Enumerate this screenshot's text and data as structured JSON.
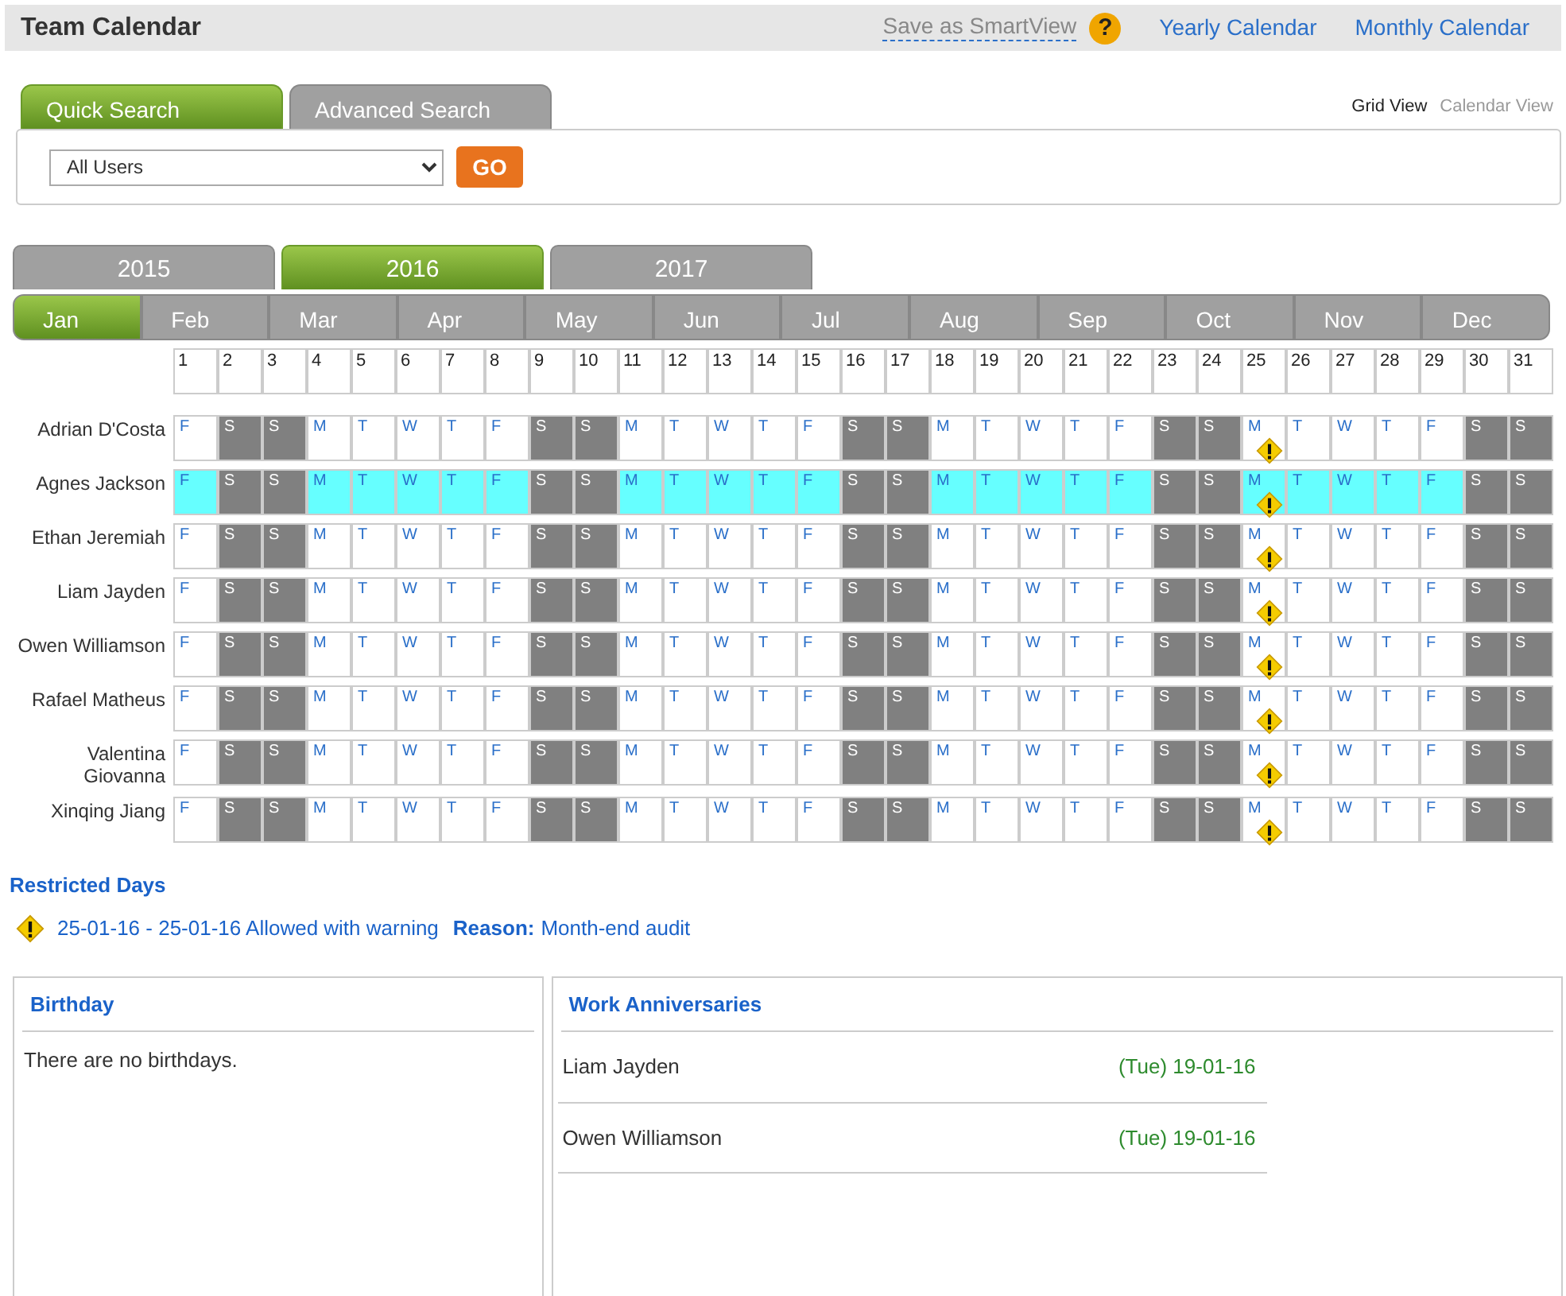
{
  "header": {
    "title": "Team Calendar",
    "save_link": "Save as SmartView",
    "help": "?",
    "links": [
      "Yearly Calendar",
      "Monthly Calendar"
    ]
  },
  "search_tabs": [
    {
      "label": "Quick Search",
      "selected": true
    },
    {
      "label": "Advanced Search",
      "selected": false
    }
  ],
  "views": [
    {
      "label": "Grid View",
      "selected": true
    },
    {
      "label": "Calendar View",
      "selected": false
    }
  ],
  "search": {
    "user_select": "All Users",
    "go_button": "GO"
  },
  "years": [
    {
      "label": "2015",
      "selected": false
    },
    {
      "label": "2016",
      "selected": true
    },
    {
      "label": "2017",
      "selected": false
    }
  ],
  "months": [
    {
      "label": "Jan",
      "selected": true
    },
    {
      "label": "Feb",
      "selected": false
    },
    {
      "label": "Mar",
      "selected": false
    },
    {
      "label": "Apr",
      "selected": false
    },
    {
      "label": "May",
      "selected": false
    },
    {
      "label": "Jun",
      "selected": false
    },
    {
      "label": "Jul",
      "selected": false
    },
    {
      "label": "Aug",
      "selected": false
    },
    {
      "label": "Sep",
      "selected": false
    },
    {
      "label": "Oct",
      "selected": false
    },
    {
      "label": "Nov",
      "selected": false
    },
    {
      "label": "Dec",
      "selected": false
    }
  ],
  "days": [
    {
      "number": "1",
      "weekend": false,
      "restricted": false
    },
    {
      "number": "2",
      "weekend": true,
      "restricted": false
    },
    {
      "number": "3",
      "weekend": true,
      "restricted": false
    },
    {
      "number": "4",
      "weekend": false,
      "restricted": false
    },
    {
      "number": "5",
      "weekend": false,
      "restricted": false
    },
    {
      "number": "6",
      "weekend": false,
      "restricted": false
    },
    {
      "number": "7",
      "weekend": false,
      "restricted": false
    },
    {
      "number": "8",
      "weekend": false,
      "restricted": false
    },
    {
      "number": "9",
      "weekend": true,
      "restricted": false
    },
    {
      "number": "10",
      "weekend": true,
      "restricted": false
    },
    {
      "number": "11",
      "weekend": false,
      "restricted": false
    },
    {
      "number": "12",
      "weekend": false,
      "restricted": false
    },
    {
      "number": "13",
      "weekend": false,
      "restricted": false
    },
    {
      "number": "14",
      "weekend": false,
      "restricted": false
    },
    {
      "number": "15",
      "weekend": false,
      "restricted": false
    },
    {
      "number": "16",
      "weekend": true,
      "restricted": false
    },
    {
      "number": "17",
      "weekend": true,
      "restricted": false
    },
    {
      "number": "18",
      "weekend": false,
      "restricted": false
    },
    {
      "number": "19",
      "weekend": false,
      "restricted": false
    },
    {
      "number": "20",
      "weekend": false,
      "restricted": false
    },
    {
      "number": "21",
      "weekend": false,
      "restricted": false
    },
    {
      "number": "22",
      "weekend": false,
      "restricted": false
    },
    {
      "number": "23",
      "weekend": true,
      "restricted": false
    },
    {
      "number": "24",
      "weekend": true,
      "restricted": false
    },
    {
      "number": "25",
      "weekend": false,
      "restricted": true
    },
    {
      "number": "26",
      "weekend": false,
      "restricted": false
    },
    {
      "number": "27",
      "weekend": false,
      "restricted": false
    },
    {
      "number": "28",
      "weekend": false,
      "restricted": false
    },
    {
      "number": "29",
      "weekend": false,
      "restricted": false
    },
    {
      "number": "30",
      "weekend": true,
      "restricted": false
    },
    {
      "number": "31",
      "weekend": true,
      "restricted": false
    }
  ],
  "employees": [
    {
      "name": "Adrian D'Costa",
      "highlighted": false,
      "cells": [
        "F",
        "S",
        "S",
        "M",
        "T",
        "W",
        "T",
        "F",
        "S",
        "S",
        "M",
        "T",
        "W",
        "T",
        "F",
        "S",
        "S",
        "M",
        "T",
        "W",
        "T",
        "F",
        "S",
        "S",
        "M",
        "T",
        "W",
        "T",
        "F",
        "S",
        "S"
      ]
    },
    {
      "name": "Agnes Jackson",
      "highlighted": true,
      "cells": [
        "F",
        "S",
        "S",
        "M",
        "T",
        "W",
        "T",
        "F",
        "S",
        "S",
        "M",
        "T",
        "W",
        "T",
        "F",
        "S",
        "S",
        "M",
        "T",
        "W",
        "T",
        "F",
        "S",
        "S",
        "M",
        "T",
        "W",
        "T",
        "F",
        "S",
        "S"
      ]
    },
    {
      "name": "Ethan Jeremiah",
      "highlighted": false,
      "cells": [
        "F",
        "S",
        "S",
        "M",
        "T",
        "W",
        "T",
        "F",
        "S",
        "S",
        "M",
        "T",
        "W",
        "T",
        "F",
        "S",
        "S",
        "M",
        "T",
        "W",
        "T",
        "F",
        "S",
        "S",
        "M",
        "T",
        "W",
        "T",
        "F",
        "S",
        "S"
      ]
    },
    {
      "name": "Liam Jayden",
      "highlighted": false,
      "cells": [
        "F",
        "S",
        "S",
        "M",
        "T",
        "W",
        "T",
        "F",
        "S",
        "S",
        "M",
        "T",
        "W",
        "T",
        "F",
        "S",
        "S",
        "M",
        "T",
        "W",
        "T",
        "F",
        "S",
        "S",
        "M",
        "T",
        "W",
        "T",
        "F",
        "S",
        "S"
      ]
    },
    {
      "name": "Owen Williamson",
      "highlighted": false,
      "cells": [
        "F",
        "S",
        "S",
        "M",
        "T",
        "W",
        "T",
        "F",
        "S",
        "S",
        "M",
        "T",
        "W",
        "T",
        "F",
        "S",
        "S",
        "M",
        "T",
        "W",
        "T",
        "F",
        "S",
        "S",
        "M",
        "T",
        "W",
        "T",
        "F",
        "S",
        "S"
      ]
    },
    {
      "name": "Rafael Matheus",
      "highlighted": false,
      "cells": [
        "F",
        "S",
        "S",
        "M",
        "T",
        "W",
        "T",
        "F",
        "S",
        "S",
        "M",
        "T",
        "W",
        "T",
        "F",
        "S",
        "S",
        "M",
        "T",
        "W",
        "T",
        "F",
        "S",
        "S",
        "M",
        "T",
        "W",
        "T",
        "F",
        "S",
        "S"
      ]
    },
    {
      "name": "Valentina Giovanna",
      "highlighted": false,
      "cells": [
        "F",
        "S",
        "S",
        "M",
        "T",
        "W",
        "T",
        "F",
        "S",
        "S",
        "M",
        "T",
        "W",
        "T",
        "F",
        "S",
        "S",
        "M",
        "T",
        "W",
        "T",
        "F",
        "S",
        "S",
        "M",
        "T",
        "W",
        "T",
        "F",
        "S",
        "S"
      ]
    },
    {
      "name": "Xinqing Jiang",
      "highlighted": false,
      "cells": [
        "F",
        "S",
        "S",
        "M",
        "T",
        "W",
        "T",
        "F",
        "S",
        "S",
        "M",
        "T",
        "W",
        "T",
        "F",
        "S",
        "S",
        "M",
        "T",
        "W",
        "T",
        "F",
        "S",
        "S",
        "M",
        "T",
        "W",
        "T",
        "F",
        "S",
        "S"
      ]
    }
  ],
  "restricted_days": {
    "title": "Restricted Days",
    "entries": [
      {
        "range": "25-01-16 - 25-01-16",
        "status": "Allowed with warning",
        "reason_label": "Reason:",
        "reason": "Month-end audit"
      }
    ]
  },
  "birthday": {
    "title": "Birthday",
    "message": "There are no birthdays."
  },
  "anniversaries": {
    "title": "Work Anniversaries",
    "items": [
      {
        "name": "Liam Jayden",
        "date": "(Tue) 19-01-16"
      },
      {
        "name": "Owen Williamson",
        "date": "(Tue) 19-01-16"
      }
    ]
  }
}
